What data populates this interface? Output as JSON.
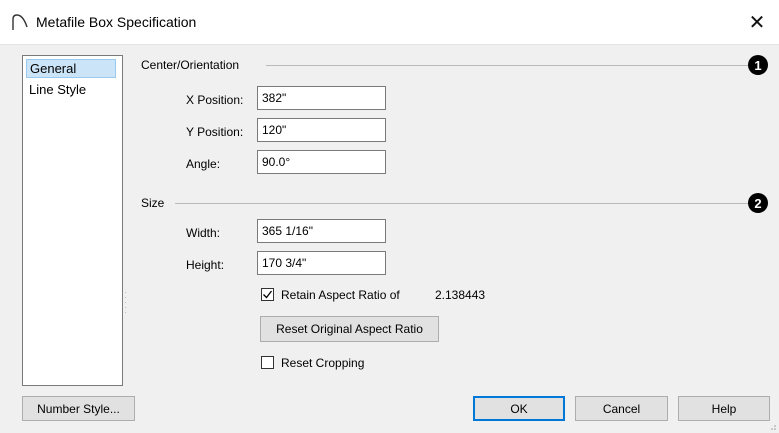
{
  "dialog": {
    "title": "Metafile Box Specification",
    "close_glyph": "✕"
  },
  "sidebar": {
    "items": [
      {
        "label": "General",
        "selected": true
      },
      {
        "label": "Line Style",
        "selected": false
      }
    ]
  },
  "center_orientation": {
    "group_label": "Center/Orientation",
    "badge": "1",
    "x_position": {
      "label": "X Position:",
      "value": "382\""
    },
    "y_position": {
      "label": "Y Position:",
      "value": "120\""
    },
    "angle": {
      "label": "Angle:",
      "value": "90.0°"
    }
  },
  "size": {
    "group_label": "Size",
    "badge": "2",
    "width": {
      "label": "Width:",
      "value": "365 1/16\""
    },
    "height": {
      "label": "Height:",
      "value": "170 3/4\""
    },
    "retain_aspect": {
      "label": "Retain Aspect Ratio of",
      "checked": true,
      "ratio": "2.138443"
    },
    "reset_aspect_button": "Reset Original Aspect Ratio",
    "reset_cropping": {
      "label": "Reset Cropping",
      "checked": false
    }
  },
  "footer": {
    "number_style": "Number Style...",
    "ok": "OK",
    "cancel": "Cancel",
    "help": "Help"
  },
  "colors": {
    "selection_bg": "#cce4f7",
    "default_button_border": "#0078d7"
  },
  "icons": [
    "dialog-arch-icon",
    "close-icon",
    "checkbox-checked-icon",
    "resize-grip-icon"
  ]
}
